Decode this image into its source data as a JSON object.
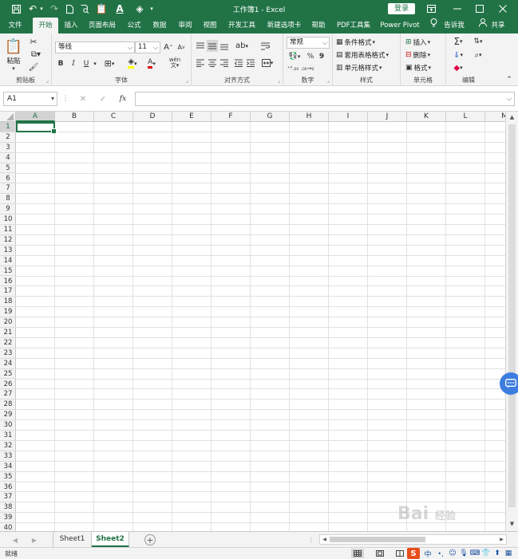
{
  "window": {
    "title": "工作簿1 - Excel",
    "sign_in": "登录"
  },
  "quick_access": {
    "save_icon": "save-icon",
    "undo_icon": "undo-icon",
    "redo_icon": "redo-icon",
    "new_icon": "new-file-icon",
    "print_preview_icon": "print-preview-icon",
    "paste_icon": "paste-icon"
  },
  "tabs": [
    {
      "label": "文件"
    },
    {
      "label": "开始"
    },
    {
      "label": "插入"
    },
    {
      "label": "页面布局"
    },
    {
      "label": "公式"
    },
    {
      "label": "数据"
    },
    {
      "label": "审阅"
    },
    {
      "label": "视图"
    },
    {
      "label": "开发工具"
    },
    {
      "label": "新建选项卡"
    },
    {
      "label": "帮助"
    },
    {
      "label": "PDF工具集"
    },
    {
      "label": "Power Pivot"
    },
    {
      "label": "告诉我"
    },
    {
      "label": "共享"
    }
  ],
  "ribbon": {
    "clipboard": {
      "label": "剪贴板",
      "paste": "粘贴"
    },
    "font": {
      "label": "字体",
      "font_name": "等线",
      "font_size": "11",
      "bold": "B",
      "italic": "I",
      "underline": "U",
      "grow": "A",
      "shrink": "A",
      "font_color": "A",
      "phonetic": "wén"
    },
    "alignment": {
      "label": "对齐方式"
    },
    "number": {
      "label": "数字",
      "format": "常规",
      "percent": "%",
      "comma": "9"
    },
    "styles": {
      "label": "样式",
      "conditional": "条件格式",
      "table": "套用表格格式",
      "cell_styles": "单元格样式"
    },
    "cells": {
      "label": "单元格",
      "insert": "插入",
      "delete": "删除",
      "format": "格式"
    },
    "editing": {
      "label": "编辑"
    }
  },
  "formula_bar": {
    "name_box": "A1",
    "fx": "fx",
    "value": ""
  },
  "sheet": {
    "columns": [
      "A",
      "B",
      "C",
      "D",
      "E",
      "F",
      "G",
      "H",
      "I",
      "J",
      "K",
      "L",
      "M"
    ],
    "rows": [
      "1",
      "2",
      "3",
      "4",
      "5",
      "6",
      "7",
      "8",
      "9",
      "10",
      "11",
      "12",
      "13",
      "14",
      "15",
      "16",
      "17",
      "18",
      "19",
      "20",
      "21",
      "22",
      "23",
      "24",
      "25",
      "26",
      "27",
      "28",
      "29",
      "30",
      "31",
      "32",
      "33",
      "34",
      "35",
      "36",
      "37",
      "38",
      "39",
      "40"
    ],
    "selected_cell": "A1"
  },
  "sheet_tabs": [
    {
      "label": "Sheet1"
    },
    {
      "label": "Sheet2"
    }
  ],
  "active_sheet": "Sheet2",
  "status": {
    "ready": "就绪",
    "ime": "中"
  },
  "watermark": {
    "text": "Bai",
    "sub": "经验"
  },
  "colors": {
    "accent": "#217346",
    "ribbon_bg": "#f3f3f3",
    "chat_bubble": "#3d7de0"
  }
}
